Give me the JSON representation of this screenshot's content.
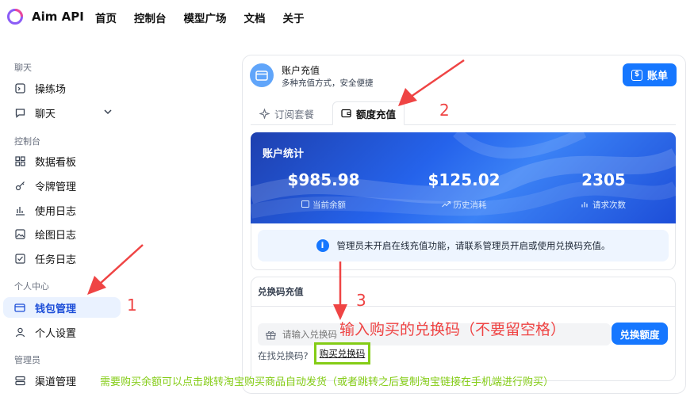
{
  "topbar": {
    "brand": "Aim API",
    "nav": [
      "首页",
      "控制台",
      "模型广场",
      "文档",
      "关于"
    ]
  },
  "sidebar": {
    "sections": [
      "聊天",
      "控制台",
      "个人中心",
      "管理员"
    ],
    "items": [
      {
        "label": "操练场",
        "icon": "playground-icon"
      },
      {
        "label": "聊天",
        "icon": "chat-icon"
      },
      {
        "label": "数据看板",
        "icon": "dashboard-icon"
      },
      {
        "label": "令牌管理",
        "icon": "key-icon"
      },
      {
        "label": "使用日志",
        "icon": "bar-chart-icon"
      },
      {
        "label": "绘图日志",
        "icon": "image-icon"
      },
      {
        "label": "任务日志",
        "icon": "checkbox-icon"
      },
      {
        "label": "钱包管理",
        "icon": "wallet-icon"
      },
      {
        "label": "个人设置",
        "icon": "user-icon"
      },
      {
        "label": "渠道管理",
        "icon": "channel-icon"
      }
    ]
  },
  "header": {
    "title": "账户充值",
    "subtitle": "多种充值方式，安全便捷",
    "bill_button": "账单"
  },
  "tabs": [
    {
      "label": "订阅套餐",
      "active": false
    },
    {
      "label": "额度充值",
      "active": true
    }
  ],
  "stats": {
    "title": "账户统计",
    "items": [
      {
        "value": "$985.98",
        "label": "当前余额"
      },
      {
        "value": "$125.02",
        "label": "历史消耗"
      },
      {
        "value": "2305",
        "label": "请求次数"
      }
    ]
  },
  "notice": "管理员未开启在线充值功能，请联系管理员开启或使用兑换码充值。",
  "redeem": {
    "title": "兑换码充值",
    "placeholder": "请输入兑换码",
    "button": "兑换额度",
    "find_text": "在找兑换码?",
    "buy_link": "购买兑换码"
  },
  "annotations": {
    "n1": "1",
    "n2": "2",
    "n3": "3",
    "input_hint": "输入购买的兑换码（不要留空格）",
    "green_hint": "需要购买余额可以点击跳转淘宝购买商品自动发货（或者跳转之后复制淘宝链接在手机端进行购买）"
  },
  "colors": {
    "primary": "#1677ff",
    "annotation_red": "#ef4444",
    "annotation_green": "#84cc16"
  }
}
